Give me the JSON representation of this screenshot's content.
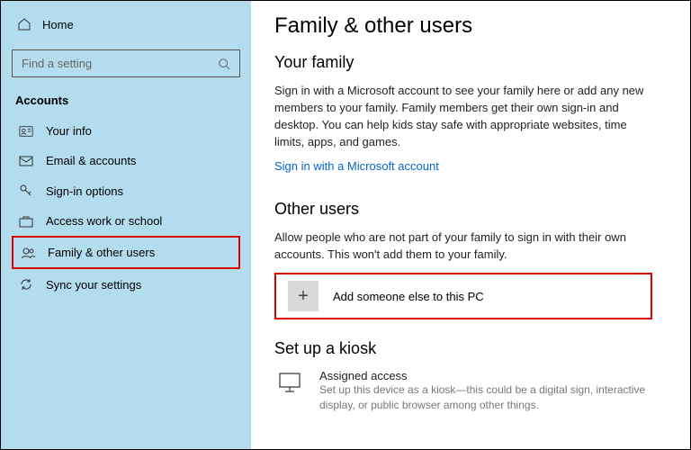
{
  "sidebar": {
    "home": "Home",
    "search_placeholder": "Find a setting",
    "section_label": "Accounts",
    "items": [
      {
        "label": "Your info"
      },
      {
        "label": "Email & accounts"
      },
      {
        "label": "Sign-in options"
      },
      {
        "label": "Access work or school"
      },
      {
        "label": "Family & other users"
      },
      {
        "label": "Sync your settings"
      }
    ]
  },
  "main": {
    "page_title": "Family & other users",
    "family": {
      "heading": "Your family",
      "body": "Sign in with a Microsoft account to see your family here or add any new members to your family. Family members get their own sign-in and desktop. You can help kids stay safe with appropriate websites, time limits, apps, and games.",
      "link": "Sign in with a Microsoft account"
    },
    "other": {
      "heading": "Other users",
      "body": "Allow people who are not part of your family to sign in with their own accounts. This won't add them to your family.",
      "add_label": "Add someone else to this PC"
    },
    "kiosk": {
      "heading": "Set up a kiosk",
      "title": "Assigned access",
      "sub": "Set up this device as a kiosk—this could be a digital sign, interactive display, or public browser among other things."
    }
  }
}
